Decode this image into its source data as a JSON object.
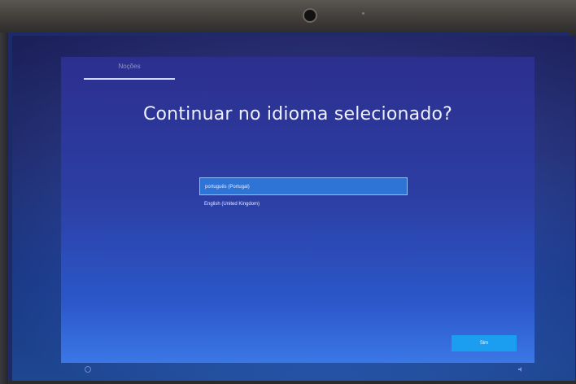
{
  "setup": {
    "step_label": "Noções",
    "title": "Continuar no idioma selecionado?",
    "languages": [
      {
        "label": "português (Portugal)",
        "selected": true
      },
      {
        "label": "English (United Kingdom)",
        "selected": false
      }
    ],
    "next_label": "Sim"
  },
  "icons": {
    "bottom_left": "accessibility-icon",
    "bottom_right": "volume-icon"
  },
  "colors": {
    "background_top": "#2c2f8e",
    "background_bottom": "#3b77e6",
    "selected_item": "#2d74d6",
    "next_button": "#1c9ef0"
  }
}
